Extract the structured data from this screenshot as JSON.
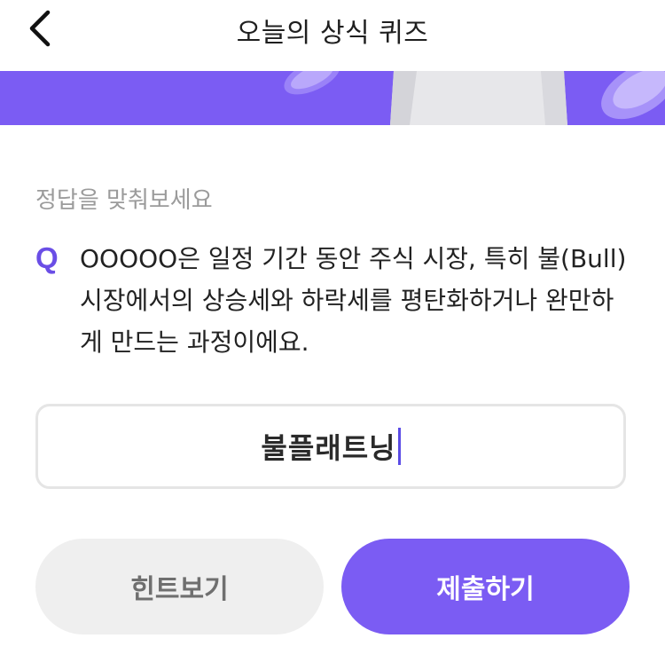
{
  "header": {
    "title": "오늘의 상식 퀴즈"
  },
  "quiz": {
    "prompt": "정답을 맞춰보세요",
    "q_label": "Q",
    "question": "OOOOO은 일정 기간 동안 주식 시장, 특히 불(Bull) 시장에서의 상승세와 하락세를 평탄화하거나 완만하게 만드는 과정이에요."
  },
  "answer": {
    "value": "불플래트닝"
  },
  "buttons": {
    "hint_label": "힌트보기",
    "submit_label": "제출하기"
  },
  "colors": {
    "accent": "#7b5cf3",
    "q_mark": "#6a4ee6",
    "hint_bg": "#efefef",
    "caret": "#5b4ce6"
  },
  "icons": {
    "back": "chevron-left-icon"
  }
}
